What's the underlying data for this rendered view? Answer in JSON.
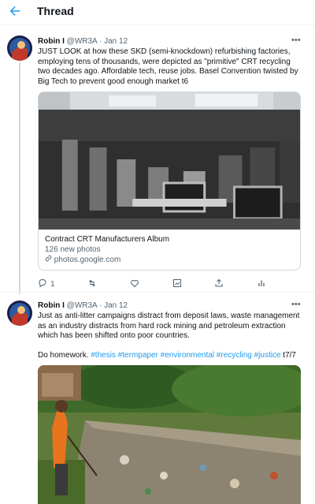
{
  "header": {
    "title": "Thread"
  },
  "tweets": [
    {
      "author_name": "Robin I",
      "author_handle": "@WR3A",
      "separator": "·",
      "date": "Jan 12",
      "text": "JUST LOOK at how these SKD (semi-knockdown) refurbishing factories, employing tens of thousands, were depicted as \"primitive\" CRT recycling two decades ago. Affordable tech, reuse jobs. Basel Convention twisted by Big Tech to prevent good enough market t6",
      "card": {
        "title": "Contract CRT Manufacturers Album",
        "subtitle": "126 new photos",
        "url": "photos.google.com"
      },
      "actions": {
        "replies": "1"
      }
    },
    {
      "author_name": "Robin I",
      "author_handle": "@WR3A",
      "separator": "·",
      "date": "Jan 12",
      "text": "Just as anti-litter campaigns distract from deposit laws, waste management as an industry distracts from hard rock mining and petroleum extraction which has been shifted onto poor countries.",
      "text2_prefix": "Do homework. ",
      "hashtags": [
        "#thesis",
        "#termpaper",
        "#environmental",
        "#recycling",
        "#justice"
      ],
      "text2_suffix": " t7/7"
    }
  ],
  "colors": {
    "accent": "#1d9bf0",
    "muted": "#536471",
    "border": "#cfd9de"
  },
  "icons": [
    "back-arrow-icon",
    "more-icon",
    "reply-icon",
    "retweet-icon",
    "like-icon",
    "analytics-icon",
    "share-icon",
    "stats-icon",
    "link-icon"
  ]
}
